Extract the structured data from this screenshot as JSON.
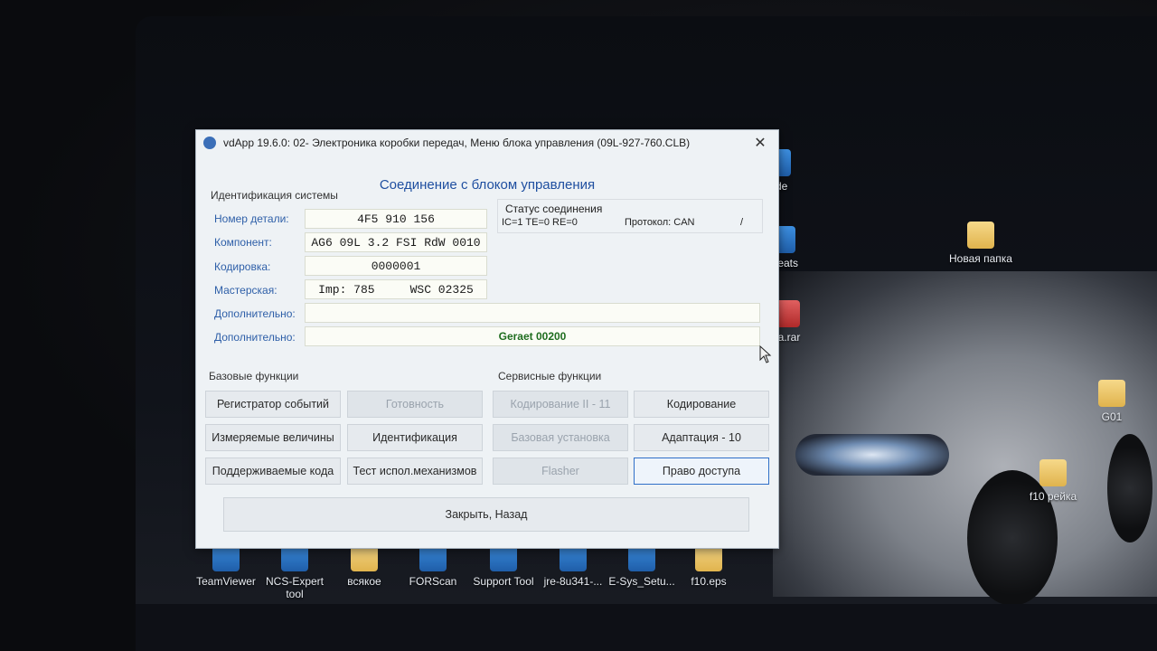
{
  "window": {
    "title": "vdApp 19.6.0: 02- Электроника коробки передач,  Меню блока управления (09L-927-760.CLB)",
    "close_glyph": "✕",
    "heading": "Соединение с блоком управления"
  },
  "identification": {
    "group_label": "Идентификация системы",
    "fields": [
      {
        "label": "Номер детали:",
        "value": "4F5 910 156"
      },
      {
        "label": "Компонент:",
        "value": "AG6 09L 3.2 FSI RdW 0010"
      },
      {
        "label": "Кодировка:",
        "value": "0000001"
      },
      {
        "label": "Мастерская:",
        "value": "Imp: 785     WSC 02325"
      },
      {
        "label": "Дополнительно:",
        "value": ""
      },
      {
        "label": "Дополнительно:",
        "value": "Geraet 00200"
      }
    ]
  },
  "status": {
    "title": "Статус соединения",
    "counters": "IC=1  TE=0   RE=0",
    "protocol": "Протокол: CAN",
    "indicator": "/"
  },
  "basic_functions": {
    "label": "Базовые функции",
    "buttons": [
      {
        "label": "Регистратор событий",
        "enabled": true
      },
      {
        "label": "Готовность",
        "enabled": false
      },
      {
        "label": "Измеряемые величины",
        "enabled": true
      },
      {
        "label": "Идентификация",
        "enabled": true
      },
      {
        "label": "Поддерживаемые кода",
        "enabled": true
      },
      {
        "label": "Тест испол.механизмов",
        "enabled": true
      }
    ]
  },
  "service_functions": {
    "label": "Сервисные функции",
    "buttons": [
      {
        "label": "Кодирование II - 11",
        "enabled": false
      },
      {
        "label": "Кодирование",
        "enabled": true
      },
      {
        "label": "Базовая установка",
        "enabled": false
      },
      {
        "label": "Адаптация - 10",
        "enabled": true
      },
      {
        "label": "Flasher",
        "enabled": false
      },
      {
        "label": "Право доступа",
        "enabled": true,
        "focused": true
      }
    ]
  },
  "footer": {
    "close_label": "Закрыть, Назад"
  },
  "desktop": {
    "icons": [
      {
        "label": "uide",
        "icon": "app-icon"
      },
      {
        "label": "Новая папка",
        "icon": "folder-icon"
      },
      {
        "label": "heeats",
        "icon": "app-icon"
      },
      {
        "label": "ka.rar",
        "icon": "archive-icon"
      },
      {
        "label": "G01",
        "icon": "folder-icon"
      },
      {
        "label": "f10 рейка",
        "icon": "folder-icon"
      },
      {
        "label": "TeamViewer",
        "icon": "teamviewer-icon"
      },
      {
        "label": "NCS-Expert tool",
        "icon": "app-icon"
      },
      {
        "label": "всякое",
        "icon": "folder-icon"
      },
      {
        "label": "FORScan",
        "icon": "app-icon"
      },
      {
        "label": "Support Tool",
        "icon": "app-icon"
      },
      {
        "label": "jre-8u341-...",
        "icon": "app-icon"
      },
      {
        "label": "E-Sys_Setu...",
        "icon": "app-icon"
      },
      {
        "label": "f10.eps",
        "icon": "file-icon"
      }
    ]
  }
}
